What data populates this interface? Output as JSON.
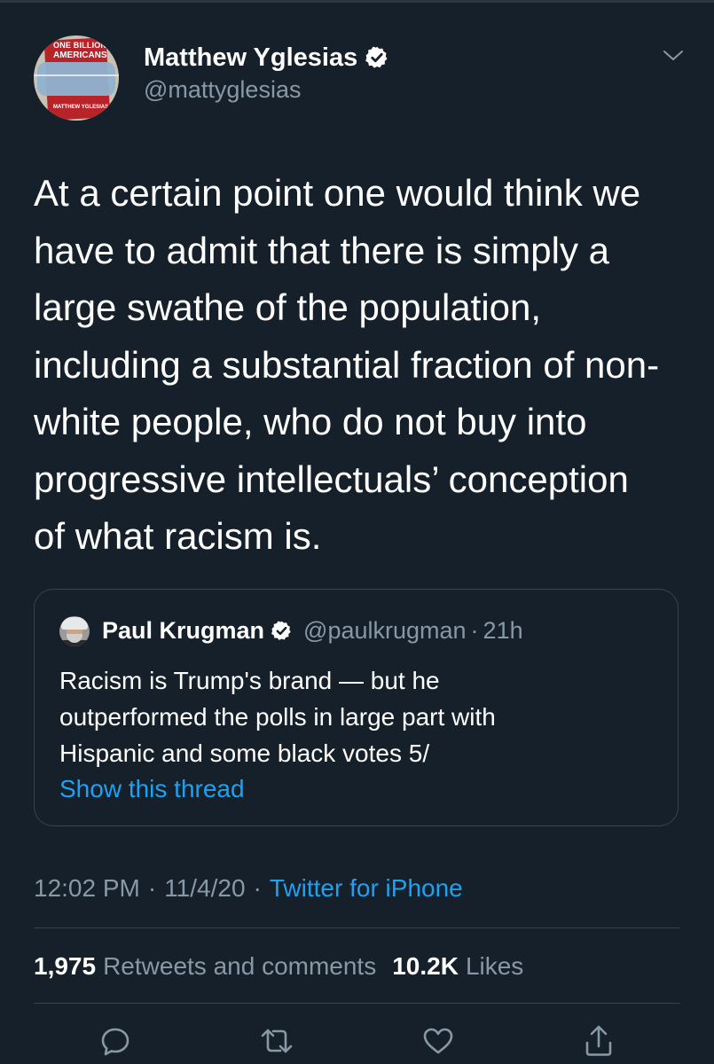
{
  "tweet": {
    "author": {
      "name": "Matthew Yglesias",
      "handle": "@mattyglesias",
      "verified": true,
      "avatar_cover_text": [
        "ONE BILLION",
        "AMERICANS",
        "MATTHEW YGLESIAS"
      ]
    },
    "text": "At a certain point one would think we\nhave to admit that there is simply a\nlarge swathe of the population,\nincluding a substantial fraction of non-\nwhite people, who do not buy into\nprogressive intellectuals’ conception\nof what racism is.",
    "quoted": {
      "name": "Paul Krugman",
      "handle": "@paulkrugman",
      "separator": "·",
      "time": "21h",
      "verified": true,
      "text": "Racism is Trump's brand — but he\noutperformed the polls in large part with\nHispanic and some black votes 5/",
      "link_label": "Show this thread"
    },
    "meta": {
      "time": "12:02 PM",
      "date": "11/4/20",
      "separator": "·",
      "source": "Twitter for iPhone"
    },
    "stats": {
      "retweets_count": "1,975",
      "retweets_label": "Retweets and comments",
      "likes_count": "10.2K",
      "likes_label": "Likes"
    }
  },
  "icons": {
    "verified": "verified-badge-icon",
    "menu": "chevron-down-icon",
    "reply": "reply-icon",
    "retweet": "retweet-icon",
    "like": "heart-icon",
    "share": "share-icon"
  },
  "colors": {
    "background": "#15202b",
    "text": "#ffffff",
    "secondary": "#8899a6",
    "link": "#1da1f2",
    "border": "#38444d"
  }
}
